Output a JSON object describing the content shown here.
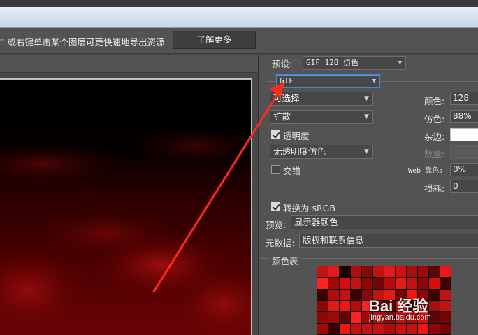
{
  "hint_bar": {
    "text": "” 或右键单击某个图层可更快速地导出资源",
    "learn_more_label": "了解更多"
  },
  "settings": {
    "preset_label": "预设:",
    "preset_value": "GIF 128 仿色",
    "format_value": "GIF",
    "reduction_value": "可选择",
    "dither_algo_value": "扩散",
    "transparency_label": "透明度",
    "transparency_checked": true,
    "matte_dither_value": "无透明度仿色",
    "interlace_label": "交错",
    "interlace_checked": false,
    "colors_label": "颜色:",
    "colors_value": "128",
    "dither_label": "仿色:",
    "dither_value": "88%",
    "matte_label": "杂边:",
    "amount_label": "数量:",
    "web_snap_label": "Web 靠色:",
    "web_snap_value": "0%",
    "lossy_label": "损耗:",
    "lossy_value": "0",
    "convert_srgb_label": "转换为 sRGB",
    "convert_srgb_checked": true,
    "preview_label": "预览:",
    "preview_value": "显示器颜色",
    "metadata_label": "元数据:",
    "metadata_value": "版权和联系信息",
    "color_table_label": "颜色表"
  },
  "colors": {
    "accent_blue": "#3c86e0",
    "annotation_red": "#ff2a1e"
  },
  "watermark": {
    "brand": "Bai 经验",
    "url": "jingyan.baidu.com"
  }
}
